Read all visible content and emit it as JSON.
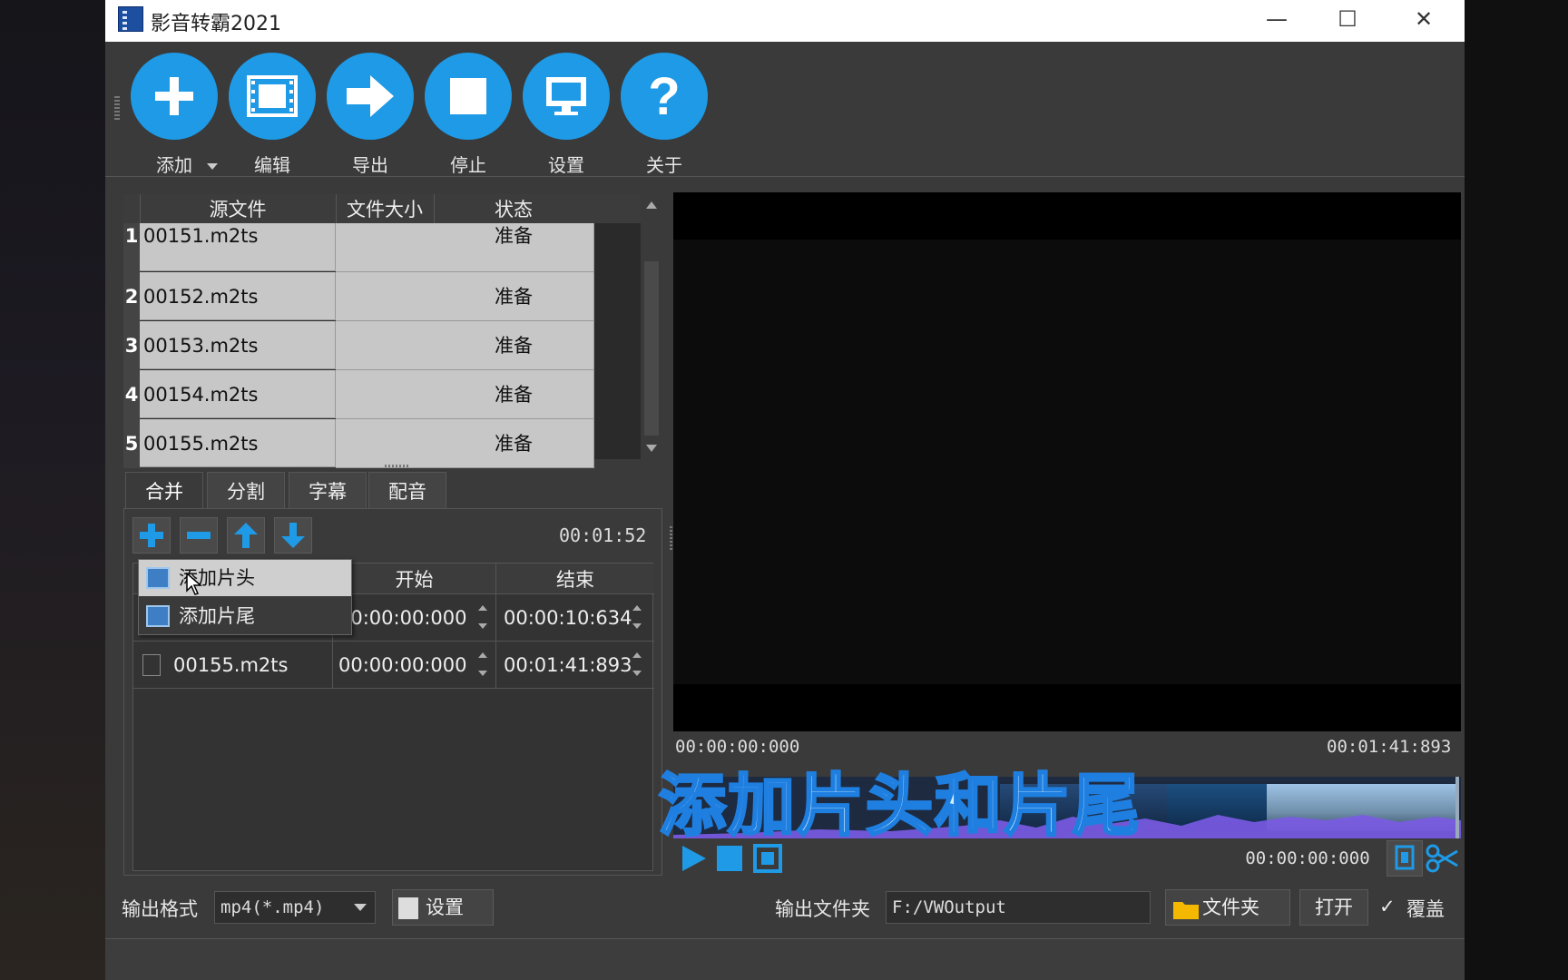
{
  "window": {
    "title": "影音转霸2021",
    "minimize": "—",
    "maximize": "☐",
    "close": "✕"
  },
  "toolbar": {
    "buttons": [
      {
        "label": "添加",
        "icon": "plus-icon"
      },
      {
        "label": "编辑",
        "icon": "film-icon"
      },
      {
        "label": "导出",
        "icon": "arrow-right-icon"
      },
      {
        "label": "停止",
        "icon": "stop-icon"
      },
      {
        "label": "设置",
        "icon": "monitor-icon"
      },
      {
        "label": "关于",
        "icon": "question-icon"
      }
    ]
  },
  "file_table": {
    "headers": [
      "源文件",
      "文件大小",
      "状态"
    ],
    "rows": [
      {
        "num": "1",
        "name": "00151.m2ts",
        "size": "",
        "status": "准备"
      },
      {
        "num": "2",
        "name": "00152.m2ts",
        "size": "",
        "status": "准备"
      },
      {
        "num": "3",
        "name": "00153.m2ts",
        "size": "",
        "status": "准备"
      },
      {
        "num": "4",
        "name": "00154.m2ts",
        "size": "",
        "status": "准备"
      },
      {
        "num": "5",
        "name": "00155.m2ts",
        "size": "",
        "status": "准备"
      }
    ]
  },
  "tabs": [
    "合并",
    "分割",
    "字幕",
    "配音"
  ],
  "merge": {
    "total_duration": "00:01:52",
    "headers": {
      "start": "开始",
      "end": "结束"
    },
    "rows": [
      {
        "name": "",
        "start": "00:00:00:000",
        "end": "00:00:10:634"
      },
      {
        "name": "00155.m2ts",
        "start": "00:00:00:000",
        "end": "00:01:41:893"
      }
    ]
  },
  "context_menu": {
    "items": [
      "添加片头",
      "添加片尾"
    ]
  },
  "preview": {
    "time_start": "00:00:00:000",
    "time_end": "00:01:41:893",
    "position": "00:00:00:000"
  },
  "overlay_caption": "添加片头和片尾",
  "output": {
    "format_label": "输出格式",
    "format_value": "mp4(*.mp4)",
    "settings_label": "设置",
    "folder_label": "输出文件夹",
    "folder_value": "F:/VWOutput",
    "folder_button": "文件夹",
    "open_button": "打开",
    "overwrite_label": "覆盖",
    "overwrite_checked": "✓"
  },
  "colors": {
    "accent": "#1e9ae6",
    "overlay_text": "#cfefff",
    "overlay_stroke": "#1f7fe0"
  }
}
